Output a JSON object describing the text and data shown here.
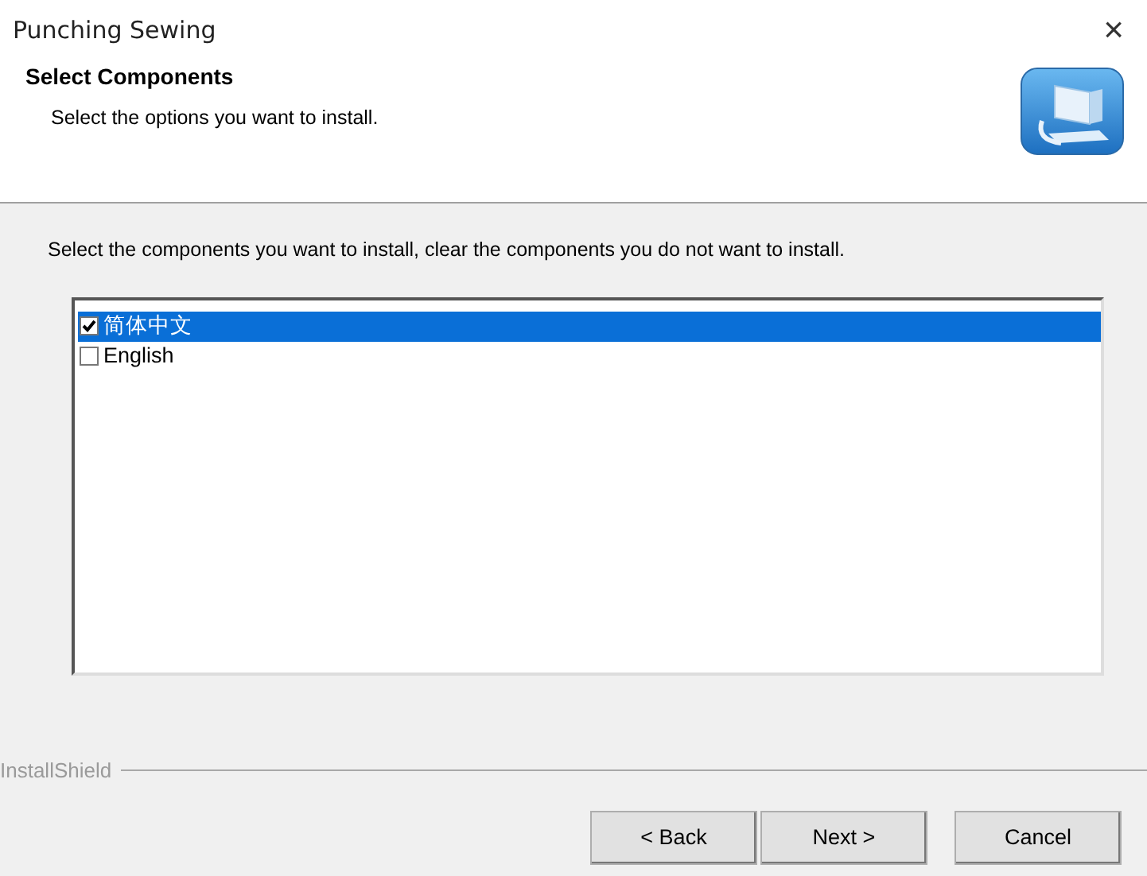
{
  "window": {
    "title": "Punching Sewing",
    "close": "×"
  },
  "header": {
    "title": "Select Components",
    "subtitle": "Select the options you want to install."
  },
  "instruction": "Select the components you want to install, clear the components you do not want to install.",
  "components": [
    {
      "label": "简体中文",
      "checked": true,
      "selected": true
    },
    {
      "label": "English",
      "checked": false,
      "selected": false
    }
  ],
  "brand": "InstallShield",
  "buttons": [
    {
      "label": "< Back",
      "kind": "back"
    },
    {
      "label": "Next >",
      "kind": "next"
    },
    {
      "label": "Cancel",
      "kind": "cancel"
    }
  ]
}
